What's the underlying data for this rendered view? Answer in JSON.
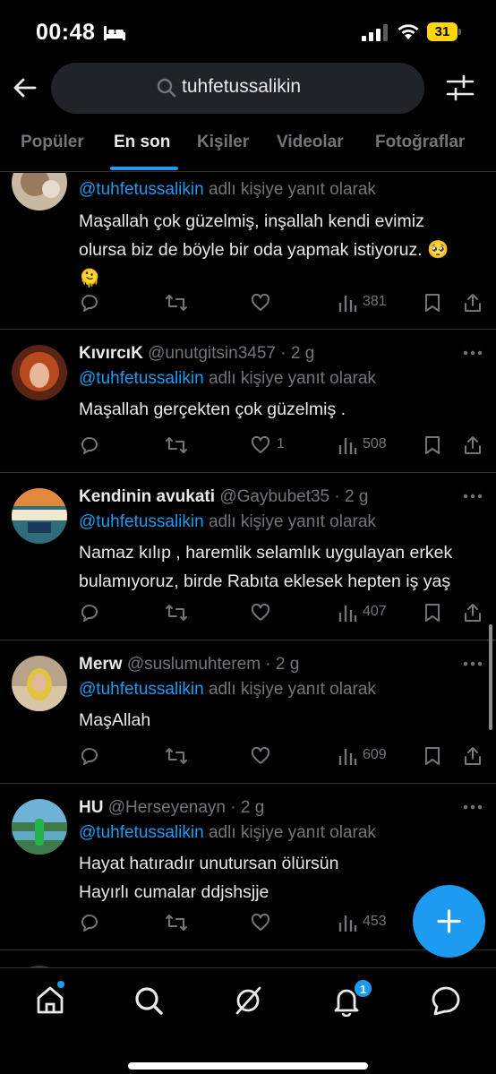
{
  "status_bar": {
    "time": "00:48",
    "battery": "31"
  },
  "search": {
    "query": "tuhfetussalikin"
  },
  "tabs": [
    {
      "label": "Popüler",
      "active": false
    },
    {
      "label": "En son",
      "active": true
    },
    {
      "label": "Kişiler",
      "active": false
    },
    {
      "label": "Videolar",
      "active": false
    },
    {
      "label": "Fotoğraflar",
      "active": false
    }
  ],
  "reply_prefix": "@tuhfetussalikin",
  "reply_suffix": " adlı kişiye yanıt olarak",
  "tweets": [
    {
      "name": "",
      "handle": "",
      "time": "",
      "lines": [
        "Maşallah çok güzelmiş, inşallah kendi evimiz",
        "olursa biz de böyle bir oda yapmak istiyoruz. 🥺",
        "🫠"
      ],
      "likes": "",
      "views": "381"
    },
    {
      "name": "KıvırcıK",
      "handle": "@unutgitsin3457",
      "time": " · 2 g",
      "lines": [
        "Maşallah gerçekten çok güzelmiş ."
      ],
      "likes": "1",
      "views": "508"
    },
    {
      "name": "Kendinin avukati",
      "handle": "@Gaybubet35",
      "time": " · 2 g",
      "lines": [
        "Namaz kılıp , haremlik selamlık uygulayan erkek",
        "bulamıyoruz, birde Rabıta eklesek hepten iş yaş"
      ],
      "likes": "",
      "views": "407"
    },
    {
      "name": "Merw",
      "handle": "@suslumuhterem",
      "time": " · 2 g",
      "lines": [
        "MaşAllah"
      ],
      "likes": "",
      "views": "609"
    },
    {
      "name": "HU",
      "handle": "@Herseyenayn",
      "time": " · 2 g",
      "lines": [
        "Hayat hatıradır unutursan ölürsün",
        "Hayırlı cumalar ddjshsjje"
      ],
      "likes": "",
      "views": "453"
    }
  ],
  "nav": {
    "notification_count": "1"
  },
  "colors": {
    "accent": "#1d9bf0",
    "muted": "#71767b",
    "text": "#e7e9ea",
    "background": "#000000",
    "divider": "#2f3336"
  }
}
